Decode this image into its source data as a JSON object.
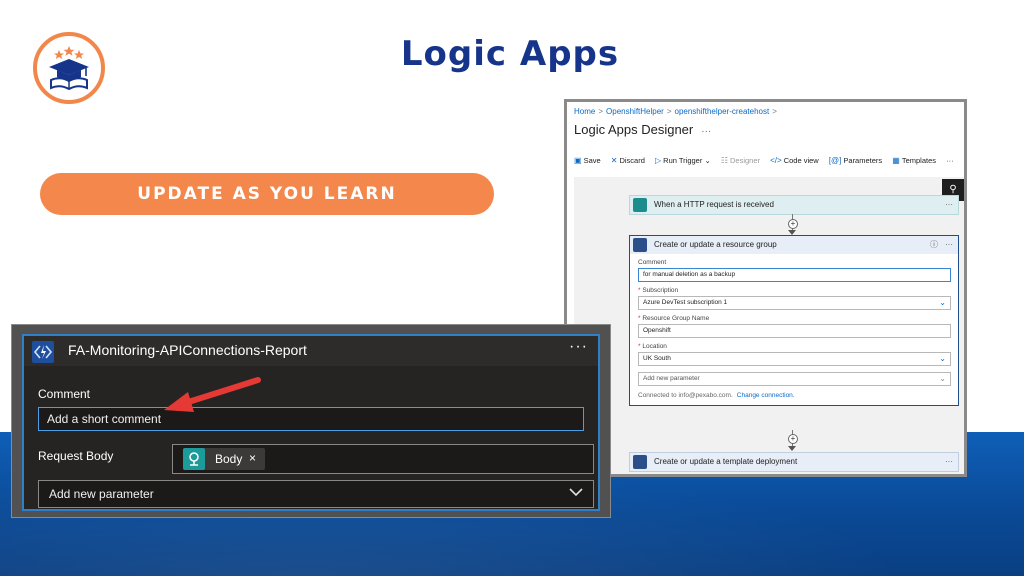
{
  "header": {
    "title": "Logic Apps",
    "tagline": "UPDATE AS YOU LEARN"
  },
  "colors": {
    "title": "#15348a",
    "accent_orange": "#f4874b",
    "band_blue": "#0a4a97",
    "azure_blue": "#0b6ac8"
  },
  "designer": {
    "breadcrumb": [
      "Home",
      "OpenshiftHelper",
      "openshifthelper-createhost"
    ],
    "title": "Logic Apps Designer",
    "title_more": "···",
    "toolbar": {
      "save": "Save",
      "discard": "Discard",
      "run_trigger": "Run Trigger",
      "designer": "Designer",
      "code_view": "Code view",
      "parameters": "Parameters",
      "templates": "Templates",
      "more": "···"
    },
    "trigger_step": {
      "title": "When a HTTP request is received",
      "more": "···"
    },
    "main_step": {
      "title": "Create or update a resource group",
      "more": "···",
      "comment_label": "Comment",
      "comment_value": "for manual deletion as a backup",
      "subscription_label": "Subscription",
      "subscription_value": "Azure DevTest subscription 1",
      "rg_label": "Resource Group Name",
      "rg_value": "Openshift",
      "location_label": "Location",
      "location_value": "UK South",
      "add_param": "Add new parameter",
      "connected_to": "Connected to info@pexabo.com.",
      "change_connection": "Change connection."
    },
    "deploy_step": {
      "title": "Create or update a template deployment",
      "more": "···"
    }
  },
  "card": {
    "title": "FA-Monitoring-APIConnections-Report",
    "more": "···",
    "comment_label": "Comment",
    "comment_placeholder": "Add a short comment",
    "request_body_label": "Request Body",
    "token_label": "Body",
    "token_remove": "×",
    "add_param": "Add new parameter"
  }
}
